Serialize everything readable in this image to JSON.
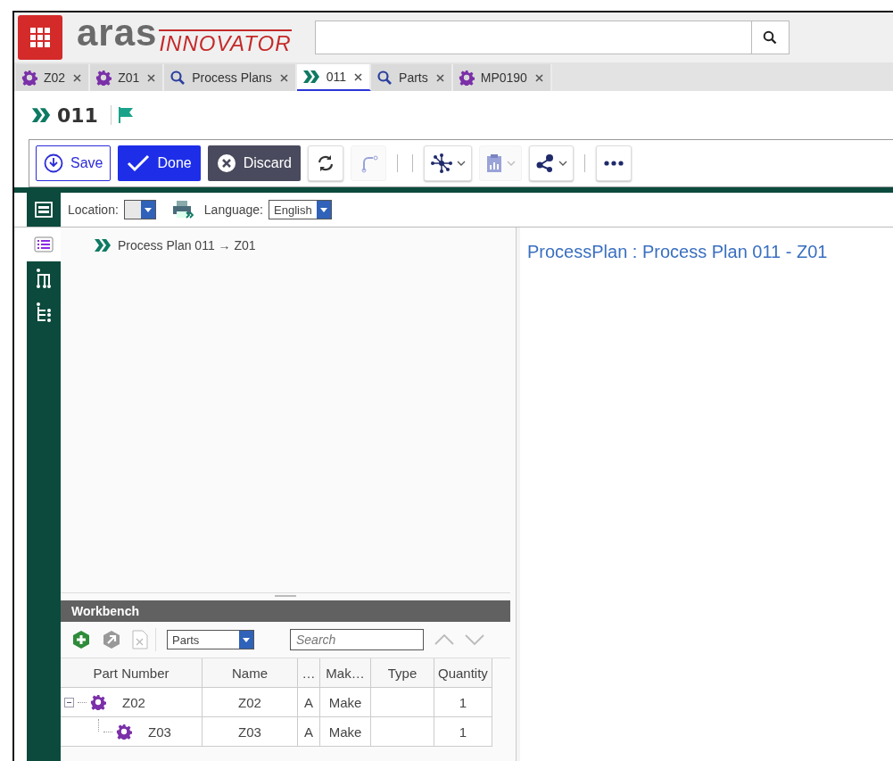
{
  "header": {
    "logo_main": "aras",
    "logo_suffix": "INNOVATOR"
  },
  "tabs": [
    {
      "label": "Z02",
      "kind": "part",
      "selected": false
    },
    {
      "label": "Z01",
      "kind": "part",
      "selected": false
    },
    {
      "label": "Process Plans",
      "kind": "search",
      "selected": false
    },
    {
      "label": "011",
      "kind": "plan",
      "selected": true
    },
    {
      "label": "Parts",
      "kind": "search",
      "selected": false
    },
    {
      "label": "MP0190",
      "kind": "part",
      "selected": false
    }
  ],
  "item": {
    "title": "011"
  },
  "toolbar": {
    "buttons": [
      {
        "kind": "save",
        "label": "Save"
      },
      {
        "kind": "done",
        "label": "Done"
      },
      {
        "kind": "discard",
        "label": "Discard"
      }
    ],
    "icon_buttons": [
      {
        "kind": "refresh",
        "disabled": false
      },
      {
        "kind": "branch",
        "disabled": true
      },
      {
        "kind": "network",
        "disabled": false
      },
      {
        "kind": "report",
        "disabled": true
      },
      {
        "kind": "share",
        "disabled": false
      },
      {
        "kind": "more",
        "disabled": false
      }
    ]
  },
  "location_bar": {
    "location_label": "Location:",
    "language_label": "Language:",
    "language_value": "English"
  },
  "side_nav": [
    {
      "kind": "form",
      "selected": true
    },
    {
      "kind": "graph",
      "selected": false
    },
    {
      "kind": "structure",
      "selected": false
    }
  ],
  "tree": {
    "label": "Process Plan 011 → Z01"
  },
  "detail": {
    "title": "ProcessPlan : Process Plan 011 - Z01"
  },
  "workbench": {
    "title": "Workbench",
    "itemtype": "Parts",
    "search": {
      "placeholder": "Search"
    },
    "columns": [
      "Part Number",
      "Name",
      "…",
      "Mak…",
      "Type",
      "Quantity"
    ],
    "rows": [
      {
        "part_number": "Z02",
        "name": "Z02",
        "column_3": "A",
        "make": "Make",
        "quantity": "1",
        "expanded": true,
        "children": [
          {
            "part_number": "Z03",
            "name": "Z03",
            "column_3": "A",
            "make": "Make",
            "quantity": "1"
          }
        ]
      }
    ]
  }
}
